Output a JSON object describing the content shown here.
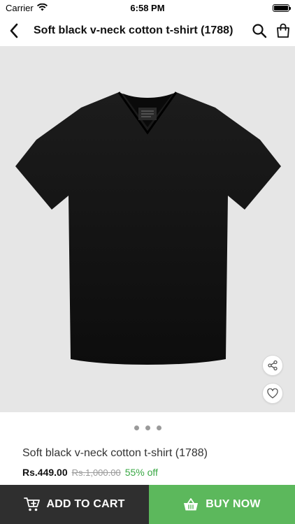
{
  "status_bar": {
    "carrier": "Carrier",
    "time": "6:58 PM",
    "battery_level": 1.0
  },
  "nav": {
    "title": "Soft black v-neck cotton t-shirt (1788)",
    "back_icon": "chevron-left-icon",
    "search_icon": "search-icon",
    "cart_icon": "shopping-bag-icon"
  },
  "gallery": {
    "image_subject": "black v-neck t-shirt",
    "page_count": 3,
    "current_page": 1,
    "share_icon": "share-icon",
    "favorite_icon": "heart-icon"
  },
  "product": {
    "name": "Soft black v-neck cotton t-shirt (1788)",
    "price": "Rs.449.00",
    "original_price": "Rs.1,000.00",
    "discount": "55% off"
  },
  "actions": {
    "add_to_cart": "ADD TO CART",
    "buy_now": "BUY NOW"
  },
  "colors": {
    "cart_button": "#2f2f2f",
    "buy_button": "#5cb85c",
    "discount_text": "#3aa845",
    "image_background": "#e6e6e6"
  }
}
